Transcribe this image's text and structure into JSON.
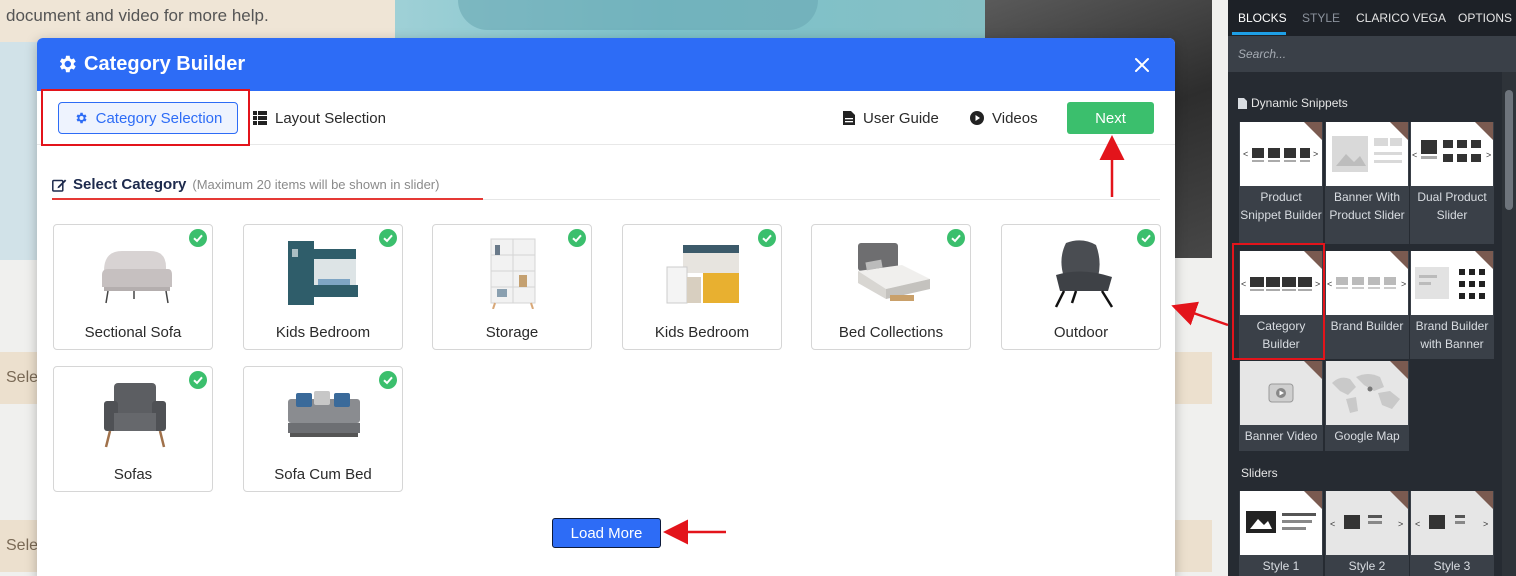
{
  "background": {
    "help_text": "document and video for more help.",
    "select_label_1": "Sele",
    "select_label_2": "Sele"
  },
  "modal": {
    "title": "Category Builder",
    "tabs": {
      "category_selection": "Category Selection",
      "layout_selection": "Layout Selection"
    },
    "actions": {
      "user_guide": "User Guide",
      "videos": "Videos",
      "next": "Next"
    },
    "section": {
      "title": "Select Category",
      "hint": "(Maximum 20 items will be shown in slider)"
    },
    "categories": [
      {
        "label": "Sectional Sofa",
        "selected": true,
        "icon": "sofa-icon"
      },
      {
        "label": "Kids Bedroom",
        "selected": true,
        "icon": "bunk-bed-icon"
      },
      {
        "label": "Storage",
        "selected": true,
        "icon": "bookshelf-icon"
      },
      {
        "label": "Kids Bedroom",
        "selected": true,
        "icon": "loft-bed-icon"
      },
      {
        "label": "Bed Collections",
        "selected": true,
        "icon": "bed-icon"
      },
      {
        "label": "Outdoor",
        "selected": true,
        "icon": "lounge-chair-icon"
      },
      {
        "label": "Sofas",
        "selected": true,
        "icon": "armchair-icon"
      },
      {
        "label": "Sofa Cum Bed",
        "selected": true,
        "icon": "sofa-bed-icon"
      }
    ],
    "load_more": "Load More"
  },
  "panel": {
    "tabs": [
      "BLOCKS",
      "STYLE",
      "CLARICO VEGA",
      "OPTIONS"
    ],
    "search_placeholder": "Search...",
    "dynamic_heading": "Dynamic Snippets",
    "dynamic_snippets": [
      {
        "label": "Product Snippet Builder"
      },
      {
        "label": "Banner With Product Slider"
      },
      {
        "label": "Dual Product Slider"
      },
      {
        "label": "Category Builder"
      },
      {
        "label": "Brand Builder"
      },
      {
        "label": "Brand Builder with Banner"
      },
      {
        "label": "Banner Video"
      },
      {
        "label": "Google Map"
      }
    ],
    "sliders_heading": "Sliders",
    "sliders": [
      {
        "label": "Style 1"
      },
      {
        "label": "Style 2"
      },
      {
        "label": "Style 3"
      }
    ]
  },
  "colors": {
    "primary": "#2d6cf6",
    "success": "#3bbf6d",
    "highlight": "#e3141b",
    "panel_bg": "#262b32"
  }
}
